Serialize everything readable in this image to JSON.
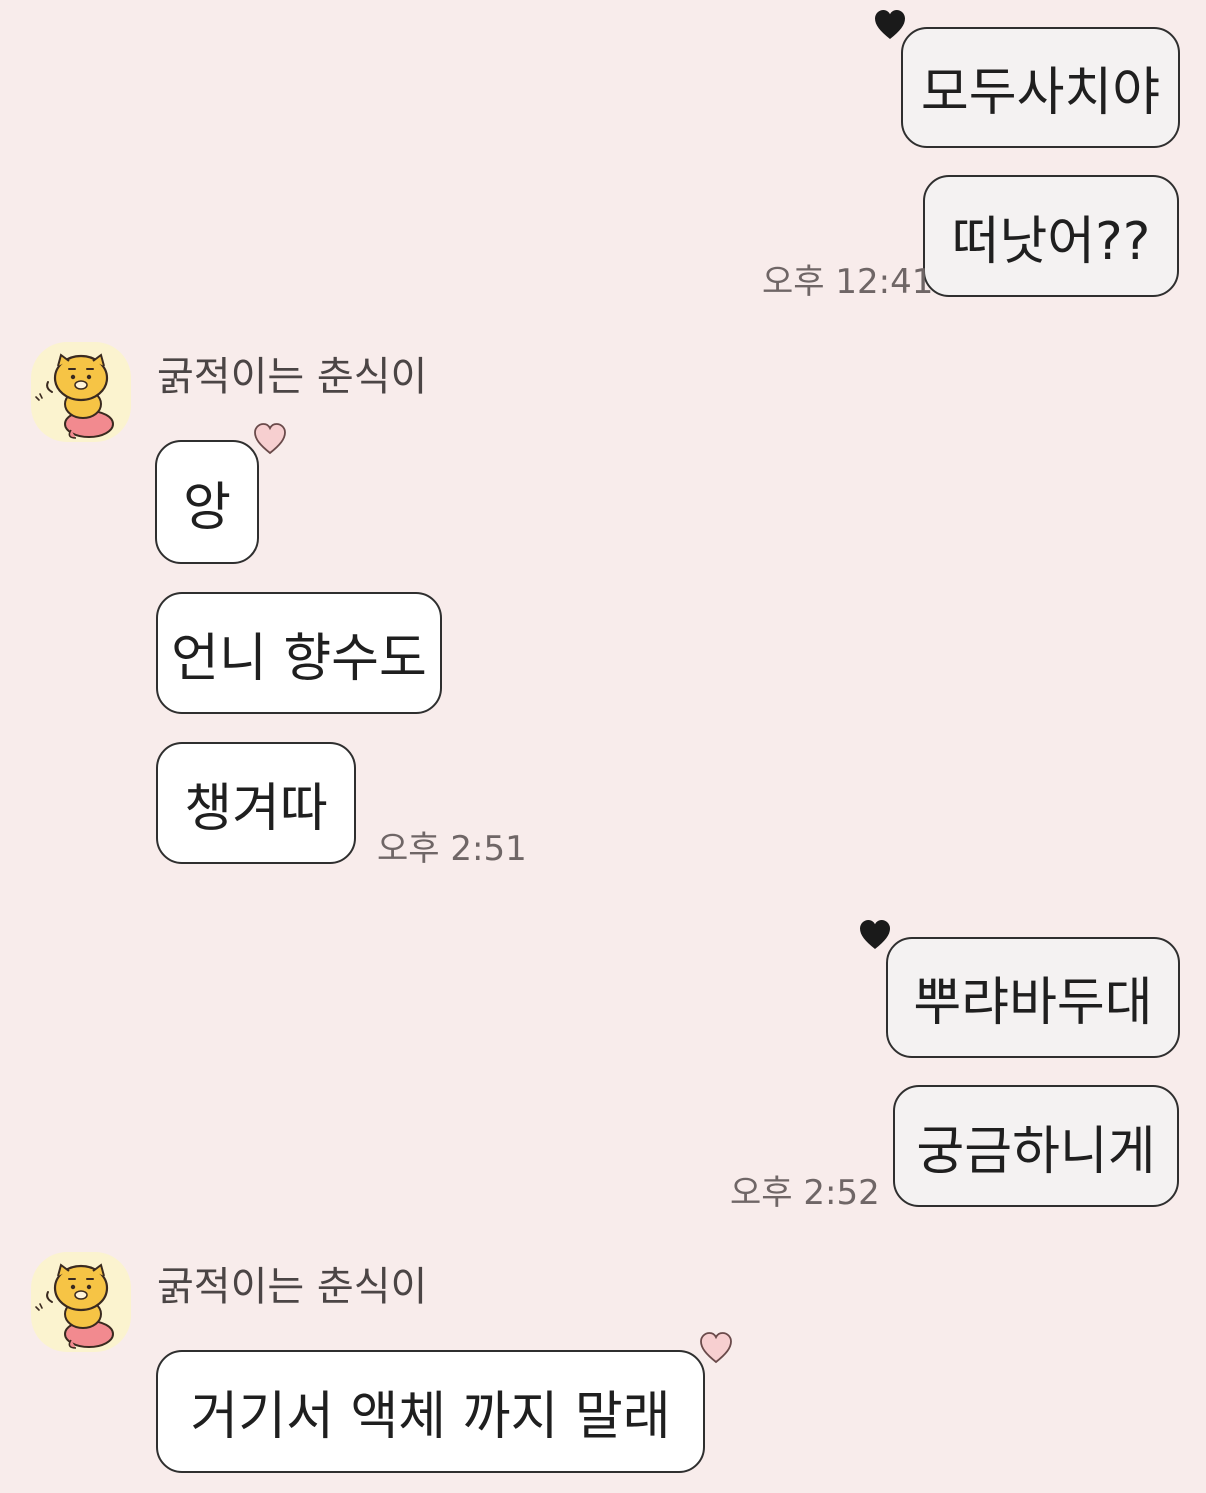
{
  "colors": {
    "background": "#f8eceb",
    "my_bubble": "#f4f2f2",
    "their_bubble": "#ffffff",
    "border": "#2f2f2f",
    "heart_mine": "#1a1a1a",
    "heart_theirs": "#f7cfd0"
  },
  "messages": {
    "m1": {
      "text": "모두사치야",
      "heart_icon": "black-heart-icon"
    },
    "m2": {
      "text": "떠낫어??",
      "time": "오후 12:41"
    },
    "group1": {
      "sender": "굵적이는 춘식이",
      "avatar_icon": "choonsik-cat-avatar"
    },
    "m3": {
      "text": "앙",
      "heart_icon": "pink-heart-icon"
    },
    "m4": {
      "text": "언니 향수도"
    },
    "m5": {
      "text": "챙겨따",
      "time": "오후 2:51"
    },
    "m6": {
      "text": "뿌랴바두대",
      "heart_icon": "black-heart-icon"
    },
    "m7": {
      "text": "궁금하니게",
      "time": "오후 2:52"
    },
    "group2": {
      "sender": "굵적이는 춘식이",
      "avatar_icon": "choonsik-cat-avatar"
    },
    "m8": {
      "text": "거기서 액체 까지 말래",
      "heart_icon": "pink-heart-icon"
    }
  }
}
